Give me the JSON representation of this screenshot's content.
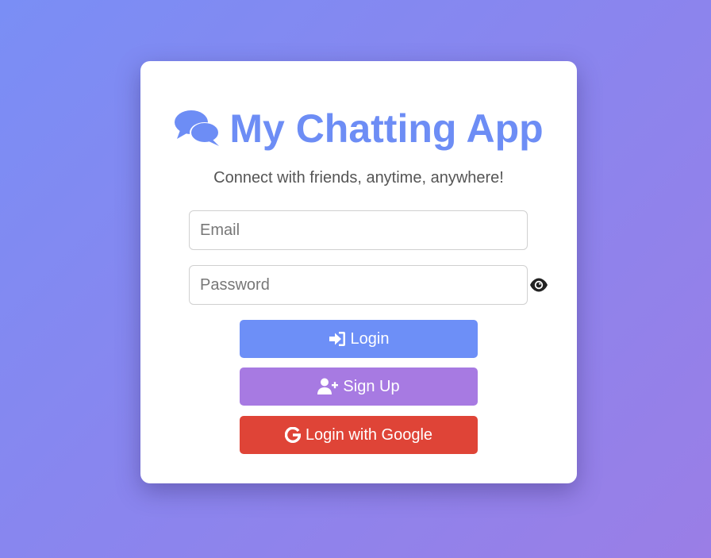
{
  "app": {
    "title": "My Chatting App",
    "subtitle": "Connect with friends, anytime, anywhere!",
    "title_icon": "comments-icon"
  },
  "form": {
    "email": {
      "placeholder": "Email",
      "value": ""
    },
    "password": {
      "placeholder": "Password",
      "value": "",
      "toggle_icon": "eye-icon"
    }
  },
  "buttons": {
    "login": {
      "label": "Login",
      "icon": "sign-in-icon",
      "color": "#6d8ff7"
    },
    "signup": {
      "label": "Sign Up",
      "icon": "user-plus-icon",
      "color": "#a77ae2"
    },
    "google": {
      "label": "Login with Google",
      "icon": "google-icon",
      "color": "#df4437"
    }
  },
  "colors": {
    "accent": "#6d8df5",
    "background_gradient": [
      "#7a8ef5",
      "#9a7ee6"
    ]
  }
}
